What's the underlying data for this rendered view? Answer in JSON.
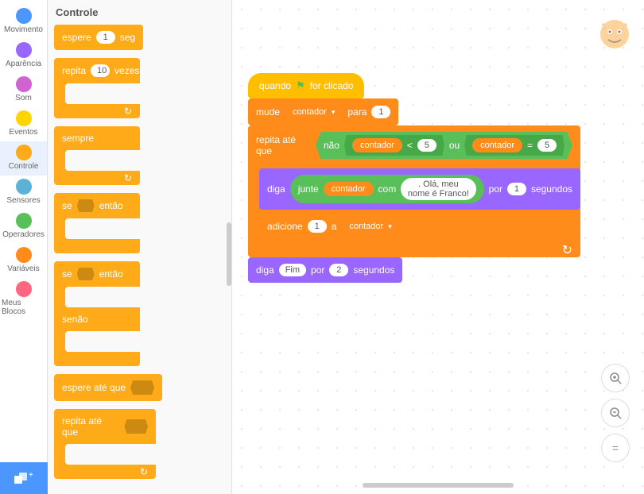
{
  "categories": [
    {
      "label": "Movimento",
      "color": "#4c97ff"
    },
    {
      "label": "Aparência",
      "color": "#9966ff"
    },
    {
      "label": "Som",
      "color": "#cf63cf"
    },
    {
      "label": "Eventos",
      "color": "#ffd500"
    },
    {
      "label": "Controle",
      "color": "#ffab19"
    },
    {
      "label": "Sensores",
      "color": "#5cb1d6"
    },
    {
      "label": "Operadores",
      "color": "#59c059"
    },
    {
      "label": "Variáveis",
      "color": "#ff8c1a"
    },
    {
      "label": "Meus Blocos",
      "color": "#ff6680"
    }
  ],
  "selected_category": "Controle",
  "palette_header": "Controle",
  "palette": {
    "wait": {
      "pre": "espere",
      "val": "1",
      "post": "seg"
    },
    "repeat": {
      "pre": "repita",
      "val": "10",
      "post": "vezes"
    },
    "forever": "sempre",
    "if": {
      "pre": "se",
      "post": "então"
    },
    "ifelse": {
      "pre": "se",
      "post": "então",
      "else": "senão"
    },
    "wait_until": "espere até que",
    "repeat_until": "repita até que"
  },
  "chart_data": {
    "type": "scratch_script",
    "blocks": [
      {
        "opcode": "event_whenflagclicked",
        "label": "quando",
        "suffix": "for clicado"
      },
      {
        "opcode": "data_setvariableto",
        "label": "mude",
        "var": "contador",
        "mid": "para",
        "val": "1"
      },
      {
        "opcode": "control_repeat_until",
        "label": "repita até que",
        "cond": {
          "op": "not",
          "label": "não",
          "inner": {
            "op": "or",
            "label": "ou",
            "left": {
              "op": "lt",
              "sym": "<",
              "a": {
                "var": "contador"
              },
              "b": "5"
            },
            "right": {
              "op": "eq",
              "sym": "=",
              "a": {
                "var": "contador"
              },
              "b": "5"
            }
          }
        },
        "body": [
          {
            "opcode": "looks_sayforsecs",
            "label": "diga",
            "text": {
              "op": "join",
              "label": "junte",
              "a": {
                "var": "contador"
              },
              "mid": "com",
              "b": ". Olá, meu nome é Franco!"
            },
            "mid": "por",
            "secs": "1",
            "suffix": "segundos"
          },
          {
            "opcode": "data_changevariableby",
            "label": "adicione",
            "val": "1",
            "mid": "a",
            "var": "contador"
          }
        ]
      },
      {
        "opcode": "looks_sayforsecs",
        "label": "diga",
        "text": "Fim",
        "mid": "por",
        "secs": "2",
        "suffix": "segundos"
      }
    ]
  },
  "zoom": {
    "in": "+",
    "out": "−",
    "reset": "="
  }
}
